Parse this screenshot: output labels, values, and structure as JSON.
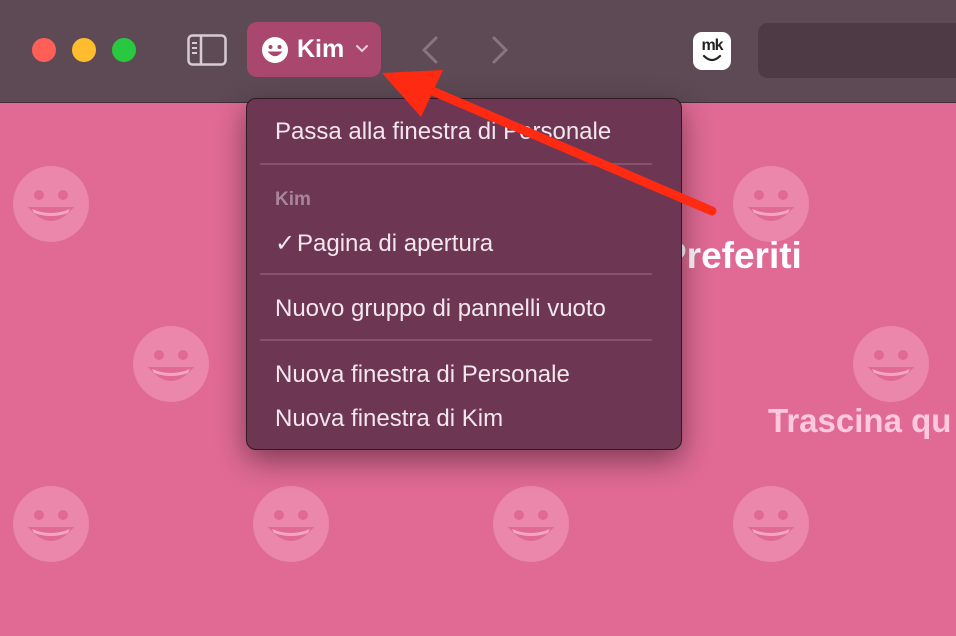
{
  "toolbar": {
    "profile_name": "Kim",
    "extension_label": "mk"
  },
  "page": {
    "favorites_title": "Preferiti",
    "drag_hint": "Trascina qu"
  },
  "menu": {
    "switch_window": "Passa alla finestra di Personale",
    "section_header": "Kim",
    "checkmark": "✓",
    "start_page": "Pagina di apertura",
    "new_empty_tab_group": "Nuovo gruppo di pannelli vuoto",
    "new_window_personal": "Nuova finestra di Personale",
    "new_window_kim": "Nuova finestra di Kim"
  },
  "colors": {
    "page_background": "#e06a94",
    "titlebar": "#5e4a55",
    "profile_button": "#a9476f",
    "menu_background": "#6d3754",
    "annotation_arrow": "#ff2a12"
  },
  "icons": {
    "window_close": "close-dot-icon",
    "window_minimize": "minimize-dot-icon",
    "window_zoom": "zoom-dot-icon",
    "sidebar": "sidebar-icon",
    "profile": "smiley-face-icon",
    "dropdown": "chevron-down-icon",
    "back": "chevron-left-icon",
    "forward": "chevron-right-icon",
    "background_pattern": "smiley-face-icon",
    "annotation": "red-arrow-icon"
  }
}
